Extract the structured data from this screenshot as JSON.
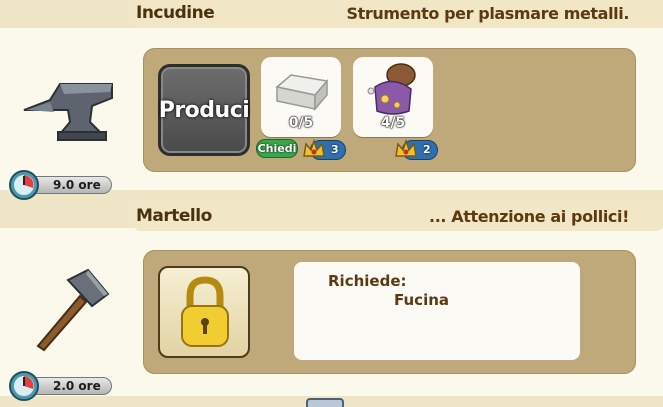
{
  "items": [
    {
      "name": "Incudine",
      "description": "Strumento per plasmare metalli.",
      "time": "9.0 ore",
      "action_label": "Produci",
      "ingredients": [
        {
          "icon": "silver-bar-icon",
          "count": "0/5",
          "action_label": "Chiedi",
          "coin_cost": "3"
        },
        {
          "icon": "coin-sack-icon",
          "count": "4/5",
          "coin_cost": "2"
        }
      ]
    },
    {
      "name": "Martello",
      "description": "... Attenzione ai pollici!",
      "time": "2.0 ore",
      "locked": true,
      "requires_label": "Richiede:",
      "requires_item": "Fucina"
    }
  ],
  "colors": {
    "panel": "#bfa97a",
    "produce_button": "#5a5a5a",
    "chiedi_button": "#3aa64a",
    "cost_badge": "#2f6fb0"
  }
}
